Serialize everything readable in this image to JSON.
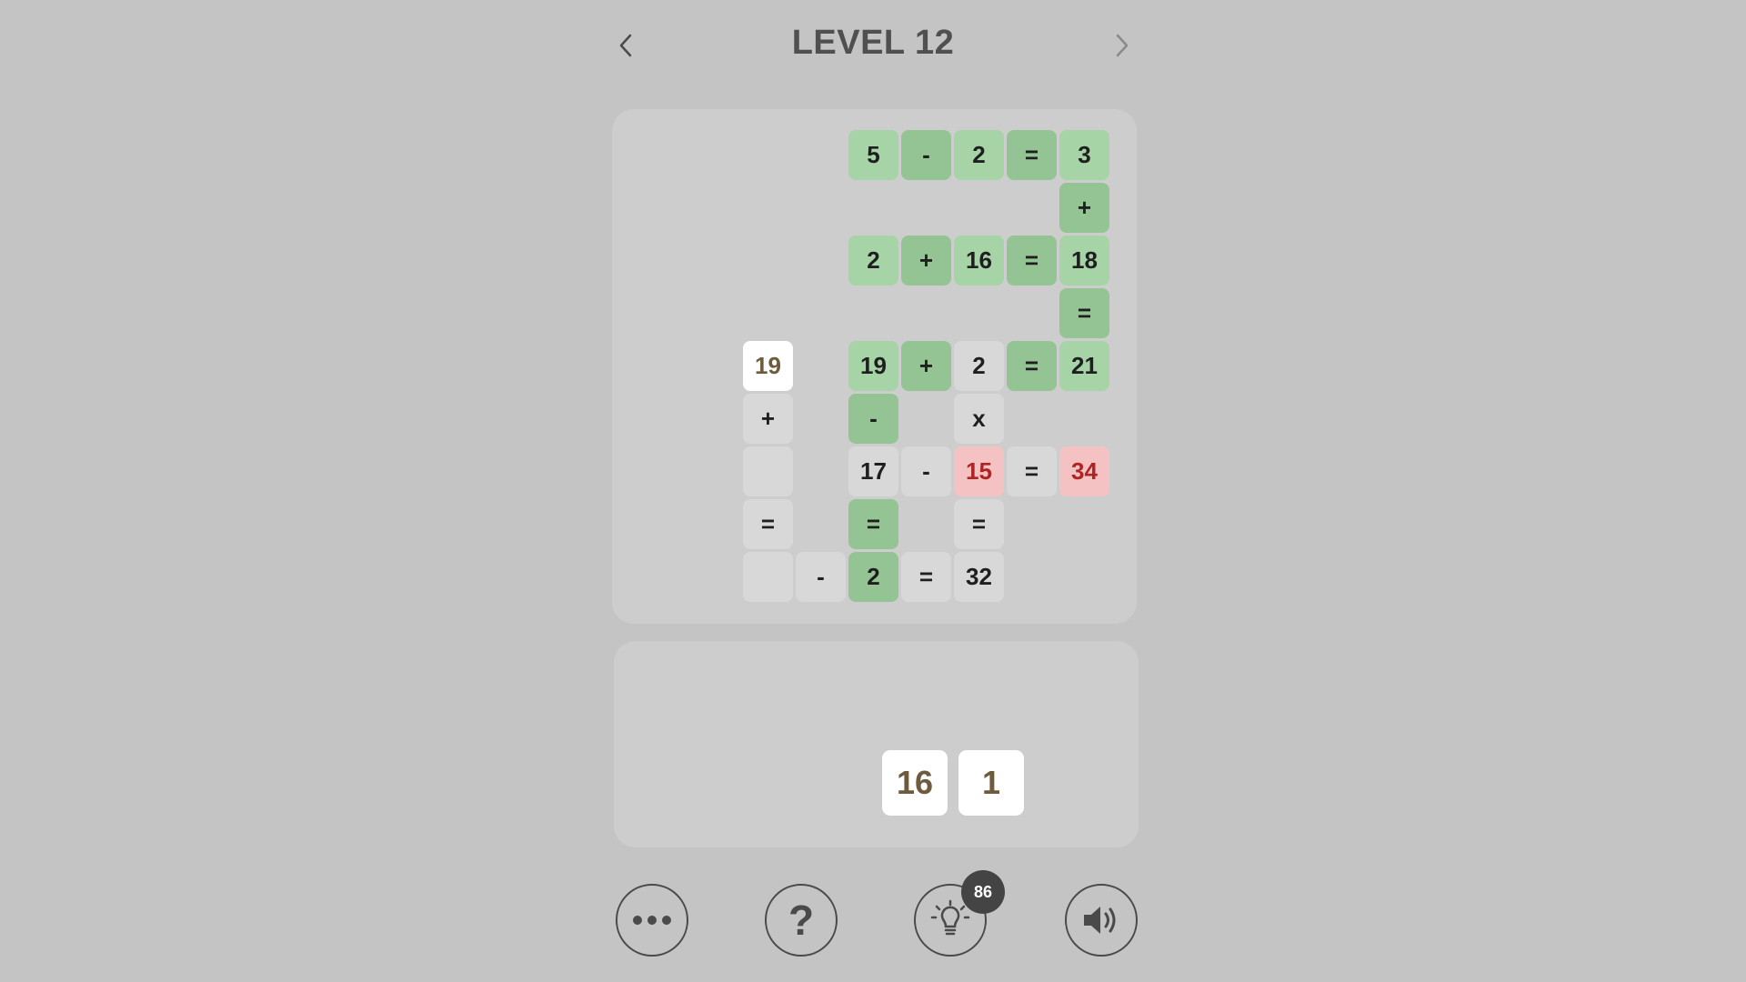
{
  "header": {
    "title": "LEVEL 12",
    "prev_icon": "chevron-left-icon",
    "next_icon": "chevron-right-icon"
  },
  "board": {
    "cells": [
      {
        "row": 0,
        "col": 3,
        "text": "5",
        "style": "num-green",
        "name": "cell-number"
      },
      {
        "row": 0,
        "col": 4,
        "text": "-",
        "style": "op-green",
        "name": "cell-operator"
      },
      {
        "row": 0,
        "col": 5,
        "text": "2",
        "style": "num-green",
        "name": "cell-number"
      },
      {
        "row": 0,
        "col": 6,
        "text": "=",
        "style": "op-green",
        "name": "cell-operator"
      },
      {
        "row": 0,
        "col": 7,
        "text": "3",
        "style": "num-green",
        "name": "cell-number"
      },
      {
        "row": 1,
        "col": 7,
        "text": "+",
        "style": "op-green",
        "name": "cell-operator"
      },
      {
        "row": 2,
        "col": 3,
        "text": "2",
        "style": "num-green",
        "name": "cell-number"
      },
      {
        "row": 2,
        "col": 4,
        "text": "+",
        "style": "op-green",
        "name": "cell-operator"
      },
      {
        "row": 2,
        "col": 5,
        "text": "16",
        "style": "num-green",
        "name": "cell-number"
      },
      {
        "row": 2,
        "col": 6,
        "text": "=",
        "style": "op-green",
        "name": "cell-operator"
      },
      {
        "row": 2,
        "col": 7,
        "text": "18",
        "style": "num-green",
        "name": "cell-number"
      },
      {
        "row": 3,
        "col": 7,
        "text": "=",
        "style": "op-green",
        "name": "cell-operator"
      },
      {
        "row": 4,
        "col": 1,
        "text": "19",
        "style": "white",
        "name": "placed-tile"
      },
      {
        "row": 4,
        "col": 3,
        "text": "19",
        "style": "num-green",
        "name": "cell-number"
      },
      {
        "row": 4,
        "col": 4,
        "text": "+",
        "style": "op-green",
        "name": "cell-operator"
      },
      {
        "row": 4,
        "col": 5,
        "text": "2",
        "style": "gray",
        "name": "cell-number"
      },
      {
        "row": 4,
        "col": 6,
        "text": "=",
        "style": "op-green",
        "name": "cell-operator"
      },
      {
        "row": 4,
        "col": 7,
        "text": "21",
        "style": "num-green",
        "name": "cell-number"
      },
      {
        "row": 5,
        "col": 1,
        "text": "+",
        "style": "gray",
        "name": "cell-operator"
      },
      {
        "row": 5,
        "col": 3,
        "text": "-",
        "style": "op-green",
        "name": "cell-operator"
      },
      {
        "row": 5,
        "col": 5,
        "text": "x",
        "style": "gray",
        "name": "cell-operator"
      },
      {
        "row": 6,
        "col": 1,
        "text": "",
        "style": "empty",
        "name": "empty-slot"
      },
      {
        "row": 6,
        "col": 3,
        "text": "17",
        "style": "gray",
        "name": "cell-number"
      },
      {
        "row": 6,
        "col": 4,
        "text": "-",
        "style": "gray",
        "name": "cell-operator"
      },
      {
        "row": 6,
        "col": 5,
        "text": "15",
        "style": "red",
        "name": "cell-number-wrong"
      },
      {
        "row": 6,
        "col": 6,
        "text": "=",
        "style": "gray",
        "name": "cell-operator"
      },
      {
        "row": 6,
        "col": 7,
        "text": "34",
        "style": "red",
        "name": "cell-number-wrong"
      },
      {
        "row": 7,
        "col": 1,
        "text": "=",
        "style": "gray",
        "name": "cell-operator"
      },
      {
        "row": 7,
        "col": 3,
        "text": "=",
        "style": "op-green",
        "name": "cell-operator"
      },
      {
        "row": 7,
        "col": 5,
        "text": "=",
        "style": "gray",
        "name": "cell-operator"
      },
      {
        "row": 8,
        "col": 1,
        "text": "",
        "style": "empty",
        "name": "empty-slot"
      },
      {
        "row": 8,
        "col": 2,
        "text": "-",
        "style": "gray",
        "name": "cell-operator"
      },
      {
        "row": 8,
        "col": 3,
        "text": "2",
        "style": "op-green",
        "name": "cell-number"
      },
      {
        "row": 8,
        "col": 4,
        "text": "=",
        "style": "gray",
        "name": "cell-operator"
      },
      {
        "row": 8,
        "col": 5,
        "text": "32",
        "style": "gray",
        "name": "cell-number"
      }
    ]
  },
  "tray": {
    "tiles": [
      {
        "text": "16",
        "slot": 0
      },
      {
        "text": "1",
        "slot": 1
      }
    ]
  },
  "controls": {
    "menu_icon": "more-dots-icon",
    "help_label": "?",
    "hint_icon": "lightbulb-icon",
    "hint_count": "86",
    "sound_icon": "speaker-icon"
  },
  "colors": {
    "background": "#c4c4c4",
    "panel": "#cdcdcd",
    "correct_number": "#a6d4a6",
    "correct_operator": "#94c494",
    "unsolved": "#d8d8d8",
    "wrong_bg": "#f4c2c2",
    "wrong_text": "#b02424",
    "tile_text": "#6e5b3e"
  }
}
